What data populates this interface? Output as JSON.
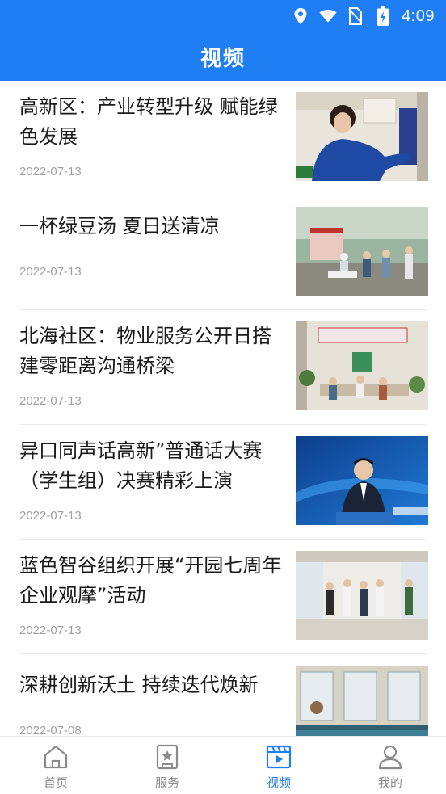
{
  "status_bar": {
    "time": "4:09"
  },
  "header": {
    "title": "视频"
  },
  "news": [
    {
      "title": "高新区：产业转型升级 赋能绿色发展",
      "date": "2022-07-13"
    },
    {
      "title": "一杯绿豆汤 夏日送清凉",
      "date": "2022-07-13"
    },
    {
      "title": "北海社区：物业服务公开日搭建零距离沟通桥梁",
      "date": "2022-07-13"
    },
    {
      "title": "异口同声话高新”普通话大赛（学生组）决赛精彩上演",
      "date": "2022-07-13"
    },
    {
      "title": "蓝色智谷组织开展“开园七周年企业观摩”活动",
      "date": "2022-07-13"
    },
    {
      "title": "深耕创新沃土 持续迭代焕新",
      "date": "2022-07-08"
    }
  ],
  "tabs": [
    {
      "label": "首页",
      "icon": "home-icon"
    },
    {
      "label": "服务",
      "icon": "service-icon"
    },
    {
      "label": "视频",
      "icon": "video-icon",
      "active": true
    },
    {
      "label": "我的",
      "icon": "user-icon"
    }
  ],
  "colors": {
    "accent": "#1f7ef3",
    "inactive": "#8a8a8a"
  }
}
